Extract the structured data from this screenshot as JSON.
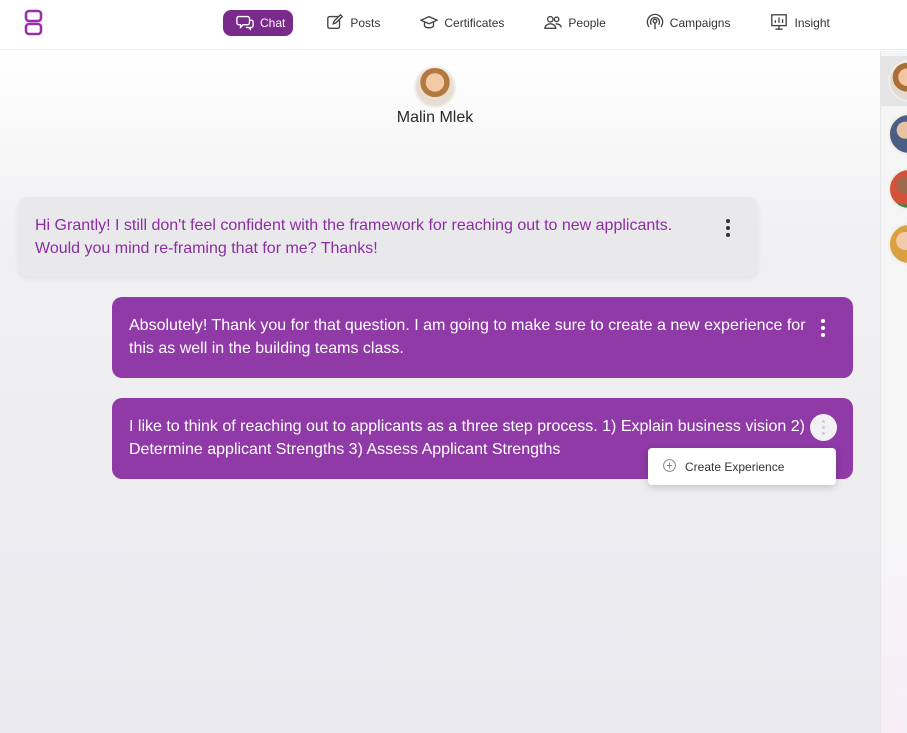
{
  "nav": {
    "items": [
      {
        "label": "Chat",
        "icon": "chat-icon",
        "active": true
      },
      {
        "label": "Posts",
        "icon": "edit-icon",
        "active": false
      },
      {
        "label": "Certificates",
        "icon": "graduation-cap-icon",
        "active": false
      },
      {
        "label": "People",
        "icon": "people-icon",
        "active": false
      },
      {
        "label": "Campaigns",
        "icon": "broadcast-icon",
        "active": false
      },
      {
        "label": "Insight",
        "icon": "presentation-chart-icon",
        "active": false
      }
    ]
  },
  "conversation": {
    "contact_name": "Malin Mlek",
    "messages": [
      {
        "direction": "incoming",
        "text": "Hi Grantly! I still don't feel confident with the framework for reaching out to new applicants. Would you mind re-framing that for me? Thanks!"
      },
      {
        "direction": "outgoing",
        "text": "Absolutely! Thank you for that question. I am going to make sure to create a new experience for this as well in the building teams class."
      },
      {
        "direction": "outgoing",
        "text": "I like to think of reaching out to applicants as a three step process. 1) Explain business vision 2) Determine applicant Strengths 3) Assess Applicant Strengths"
      }
    ]
  },
  "message_menu": {
    "items": [
      {
        "label": "Create Experience",
        "icon": "plus-circle-icon"
      }
    ]
  },
  "colors": {
    "accent": "#8f3aa6",
    "nav_active": "#7a2a8a",
    "incoming_text": "#8a2ea0",
    "incoming_bg": "#e9e9ec"
  }
}
